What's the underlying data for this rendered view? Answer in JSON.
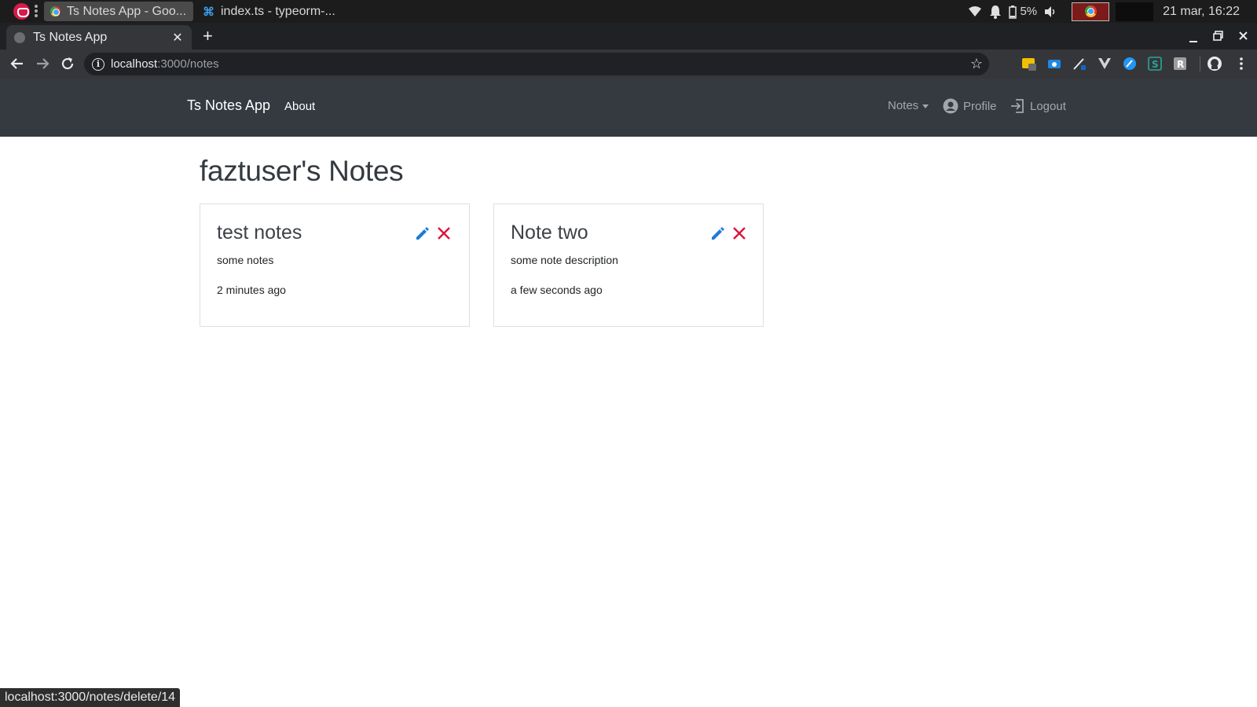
{
  "os": {
    "tasks": [
      {
        "label": "Ts Notes App - Goo...",
        "icon": "chrome-icon"
      },
      {
        "label": "index.ts - typeorm-...",
        "icon": "vscode-icon"
      }
    ],
    "battery": "5%",
    "clock": "21 mar, 16:22"
  },
  "browser": {
    "tab_title": "Ts Notes App",
    "tab_close": "✕",
    "new_tab": "+",
    "url_host": "localhost",
    "url_path": ":3000/notes",
    "status_url": "localhost:3000/notes/delete/14"
  },
  "nav": {
    "brand": "Ts Notes App",
    "about": "About",
    "notes": "Notes",
    "profile": "Profile",
    "logout": "Logout"
  },
  "page": {
    "title": "faztuser's Notes"
  },
  "notes": [
    {
      "title": "test notes",
      "description": "some notes",
      "time": "2 minutes ago"
    },
    {
      "title": "Note two",
      "description": "some note description",
      "time": "a few seconds ago"
    }
  ],
  "colors": {
    "navbar": "#343a40",
    "edit_icon": "#1e7bd9",
    "delete_icon": "#dc143c"
  }
}
